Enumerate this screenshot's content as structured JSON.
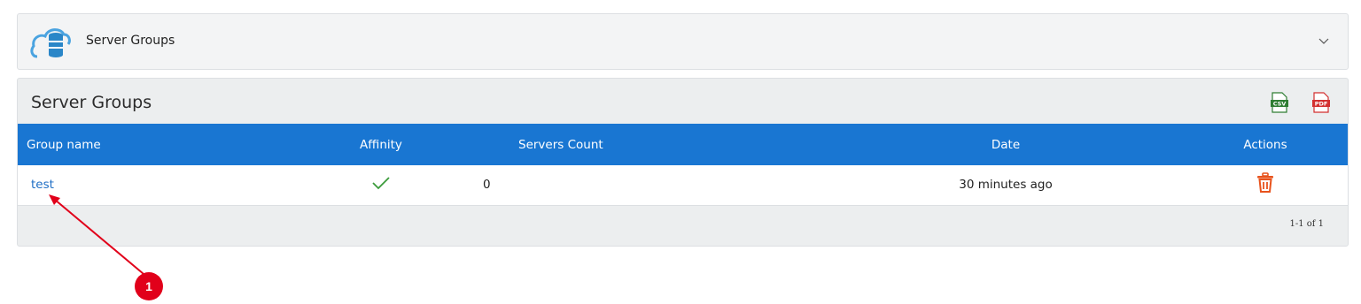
{
  "header": {
    "title": "Server Groups"
  },
  "panel": {
    "title": "Server Groups"
  },
  "table": {
    "columns": [
      "Group name",
      "Affinity",
      "Servers Count",
      "Date",
      "Actions"
    ],
    "rows": [
      {
        "name": "test",
        "affinity": true,
        "servers_count": "0",
        "date": "30 minutes ago"
      }
    ]
  },
  "pagination": {
    "text": "1-1 of 1"
  },
  "annotation": {
    "label": "1"
  },
  "colors": {
    "header_blue": "#1976d2",
    "link": "#1f6fc5",
    "trash": "#e8531d",
    "check": "#3b9b3b",
    "annotation": "#e1001a"
  }
}
